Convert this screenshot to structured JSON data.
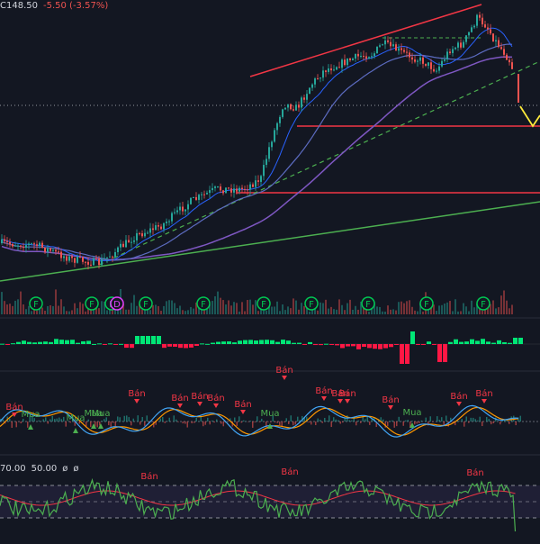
{
  "header": {
    "price_label": "C148.50",
    "change_label": "-5.50 (-3.57%)"
  },
  "rsi_header": {
    "upper_label": "70.00",
    "lower_label": "50.00",
    "phi1": "ø",
    "phi2": "ø"
  },
  "colors": {
    "background": "#131722",
    "up": "#26a69a",
    "down": "#ef5350",
    "trend_red": "#f23645",
    "trend_green": "#4caf50",
    "ma_purple": "#7e57c2",
    "ma_blue": "#2962ff",
    "rsi_green": "#4caf50",
    "macd_up": "#00e676",
    "macd_down": "#ff1744",
    "signal_yellow": "#ffeb3b"
  },
  "chart_data": {
    "type": "candlestick",
    "description_note": "",
    "price_series_trend": [],
    "event_markers": [
      "F",
      "F",
      "F",
      "D",
      "F",
      "F",
      "F",
      "F",
      "F",
      "F",
      "F",
      "F"
    ],
    "signal_labels": {
      "sell": "Bán",
      "buy": "Mua"
    },
    "sell_signals_osc": [
      "Bán",
      "Bán",
      "Bán",
      "Bán",
      "Bán",
      "Bán",
      "Bán",
      "Bán",
      "Bán",
      "Bán",
      "Bán",
      "Bán",
      "Bán"
    ],
    "buy_signals_osc": [
      "Mua",
      "Mua",
      "Mua",
      "Mua",
      "Mua",
      "Mua"
    ],
    "rsi_sell_signals": [
      "Bán",
      "Bán",
      "Bán"
    ],
    "rsi_levels": [
      70,
      50
    ]
  }
}
